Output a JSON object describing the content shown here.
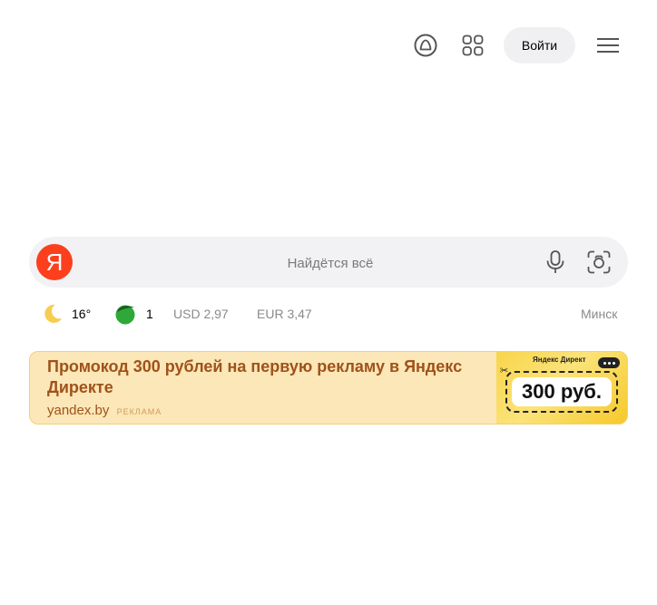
{
  "header": {
    "alice_icon": "alice-icon",
    "services_icon": "services-grid-icon",
    "login_label": "Войти",
    "menu_icon": "hamburger-menu-icon"
  },
  "search": {
    "logo_letter": "Я",
    "placeholder": "Найдётся всё",
    "mic_icon": "microphone-icon",
    "camera_icon": "camera-search-icon"
  },
  "info": {
    "weather_icon": "moon-icon",
    "temperature": "16°",
    "traffic_icon": "traffic-level-icon",
    "traffic_level": "1",
    "usd": "USD 2,97",
    "eur": "EUR 3,47",
    "city": "Минск"
  },
  "ad": {
    "title": "Промокод 300 рублей на первую рекламу в Яндекс Директе",
    "domain": "yandex.by",
    "label": "РЕКЛАМА",
    "banner_brand": "Яндекс Директ",
    "banner_amount": "300 руб."
  },
  "colors": {
    "brand_red": "#fc3f1d",
    "ad_background": "#fbe7b8",
    "ad_text": "#a0521a",
    "traffic_green": "#2fa83a"
  }
}
